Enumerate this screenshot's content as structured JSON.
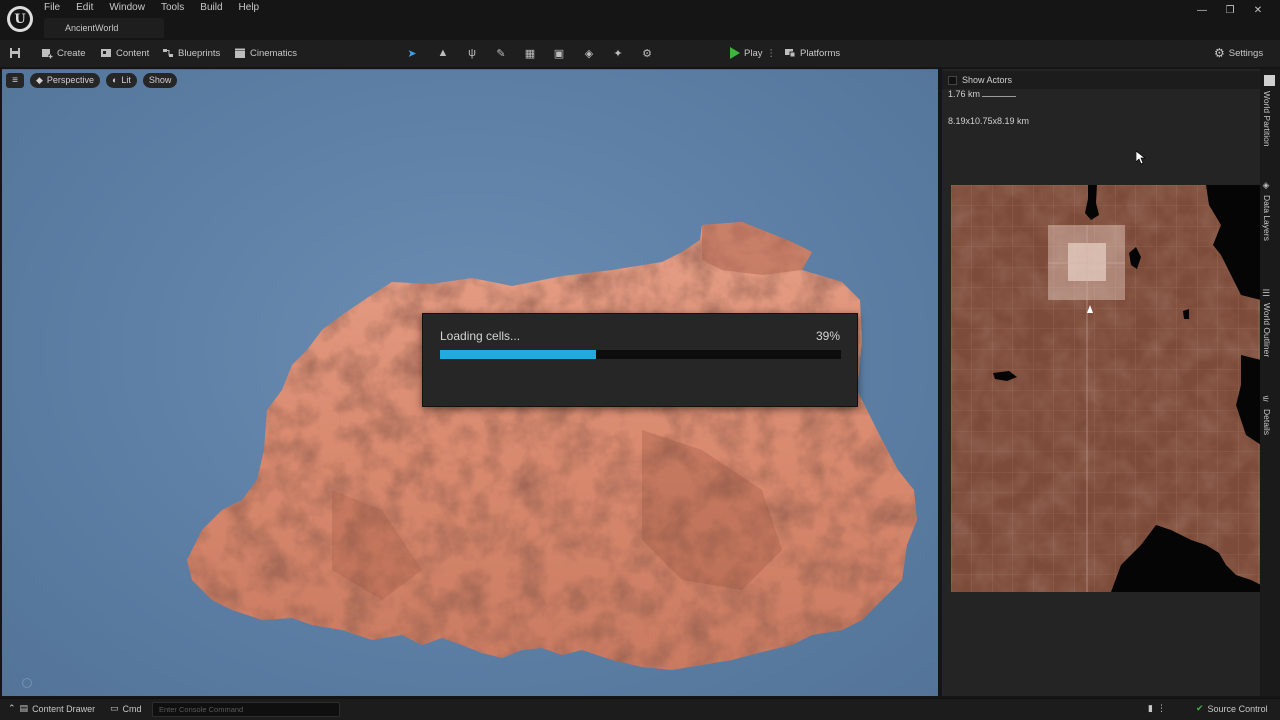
{
  "app": {
    "project_tab": "AncientWorld"
  },
  "menu": {
    "items": [
      "File",
      "Edit",
      "Window",
      "Tools",
      "Build",
      "Help"
    ]
  },
  "window_controls": {
    "minimize": "—",
    "restore": "❐",
    "close": "✕"
  },
  "toolbar": {
    "create_label": "Create",
    "content_label": "Content",
    "blueprints_label": "Blueprints",
    "cinematics_label": "Cinematics",
    "play_label": "Play",
    "platforms_label": "Platforms",
    "settings_label": "Settings",
    "mode_icons": [
      "select-mode-icon",
      "landscape-mode-icon",
      "foliage-mode-icon",
      "mesh-paint-mode-icon",
      "fracture-mode-icon",
      "brush-edit-mode-icon",
      "animation-mode-icon",
      "modeling-mode-icon",
      "geometry-mode-icon"
    ]
  },
  "viewport": {
    "perspective_label": "Perspective",
    "lit_label": "Lit",
    "show_label": "Show",
    "background_color": "#5e80a6",
    "terrain_color": "#d98a6f"
  },
  "loading_dialog": {
    "message": "Loading cells...",
    "percent_text": "39%",
    "progress": 0.39,
    "bar_color": "#24a8df"
  },
  "world_partition": {
    "show_actors_label": "Show Actors",
    "scale_label": "1.76 km",
    "dimensions_label": "8.19x10.75x8.19 km"
  },
  "side_tabs": [
    "World Partition",
    "Data Layers",
    "World Outliner",
    "Details"
  ],
  "statusbar": {
    "content_drawer_label": "Content Drawer",
    "cmd_label": "Cmd",
    "console_placeholder": "Enter Console Command",
    "source_control_label": "Source Control"
  }
}
